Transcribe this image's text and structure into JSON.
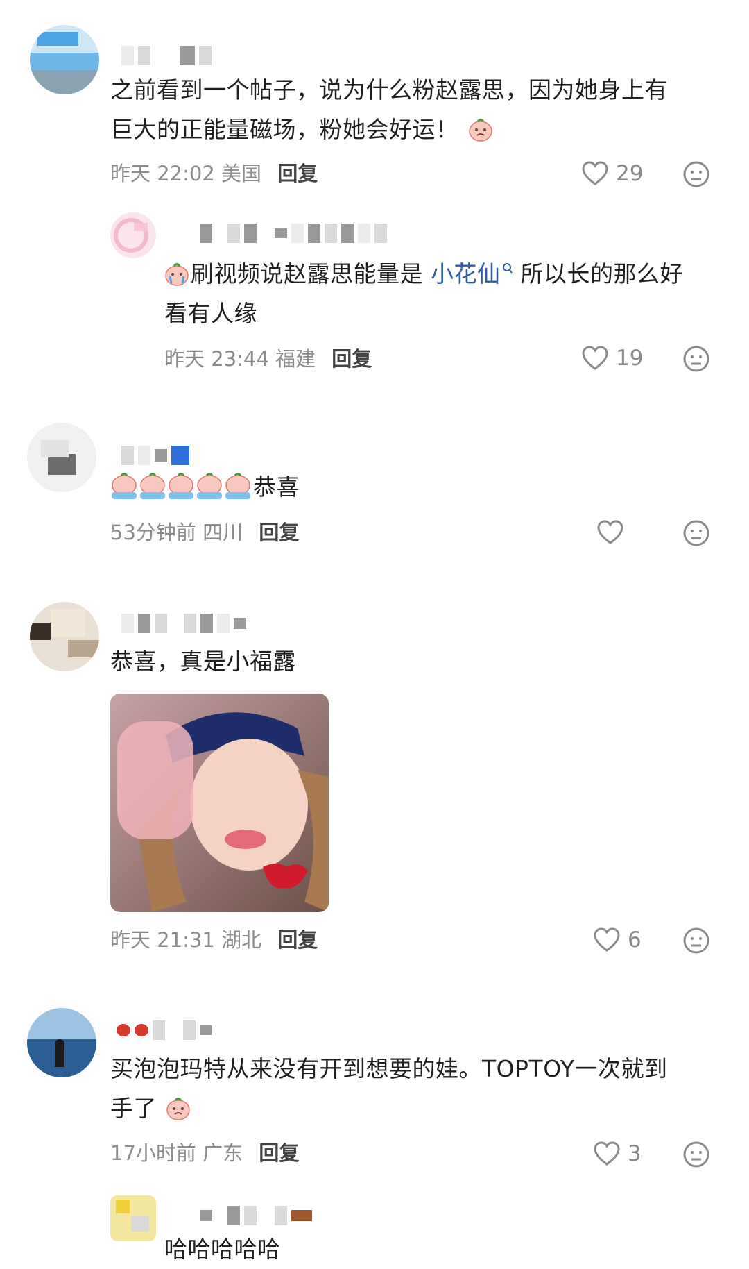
{
  "comments": [
    {
      "text_line1": "之前看到一个帖子，说为什么粉赵露思，因为她身上有",
      "text_line2": "巨大的正能量磁场，粉她会好运！",
      "time": "昨天 22:02",
      "location": "美国",
      "reply_label": "回复",
      "likes": "29"
    },
    {
      "text_pre": "刷视频说赵露思能量是",
      "text_link": "小花仙",
      "text_post": "所以长的那么好",
      "text_line2": "看有人缘",
      "time": "昨天 23:44",
      "location": "福建",
      "reply_label": "回复",
      "likes": "19"
    },
    {
      "text": "恭喜",
      "time": "53分钟前",
      "location": "四川",
      "reply_label": "回复",
      "likes": ""
    },
    {
      "text": "恭喜，真是小福露",
      "time": "昨天 21:31",
      "location": "湖北",
      "reply_label": "回复",
      "likes": "6"
    },
    {
      "text_line1": "买泡泡玛特从来没有开到想要的娃。TOPTOY一次就到",
      "text_line2": "手了",
      "time": "17小时前",
      "location": "广东",
      "reply_label": "回复",
      "likes": "3"
    },
    {
      "text": "哈哈哈哈哈"
    }
  ],
  "icons": {
    "like": "heart-outline-icon",
    "dislike": "neutral-face-icon",
    "emoji": "peach-cry-emoji",
    "search_hint": "search-link-icon"
  },
  "colors": {
    "link": "#2f5d9f",
    "meta": "#8c8c8c",
    "text": "#1f1f1f"
  }
}
